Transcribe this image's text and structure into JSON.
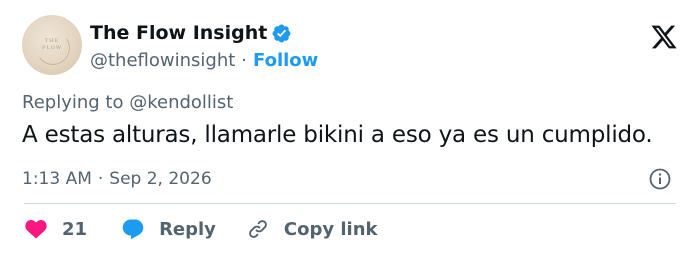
{
  "author": {
    "display_name": "The Flow Insight",
    "handle": "@theflowinsight",
    "separator": "·",
    "follow_label": "Follow",
    "avatar_logo_line1": "THE",
    "avatar_logo_line2": "FLOW"
  },
  "tweet": {
    "replying_prefix": "Replying to",
    "replying_to": "@kendollist",
    "text": "A estas alturas, llamarle bikini a eso ya es un cumplido.",
    "time": "1:13 AM",
    "meta_separator": "·",
    "date": "Sep 2, 2026"
  },
  "actions": {
    "like_count": "21",
    "reply_label": "Reply",
    "copy_link_label": "Copy link"
  },
  "colors": {
    "accent": "#1d9bf0",
    "like": "#f91880",
    "text_primary": "#0f1419",
    "text_secondary": "#536471",
    "divider": "#cfd9de"
  },
  "icons": {
    "verified": "verified-badge-icon",
    "brand": "x-logo-icon",
    "info": "info-icon",
    "like": "heart-icon",
    "reply": "speech-bubble-icon",
    "copy": "link-icon"
  }
}
